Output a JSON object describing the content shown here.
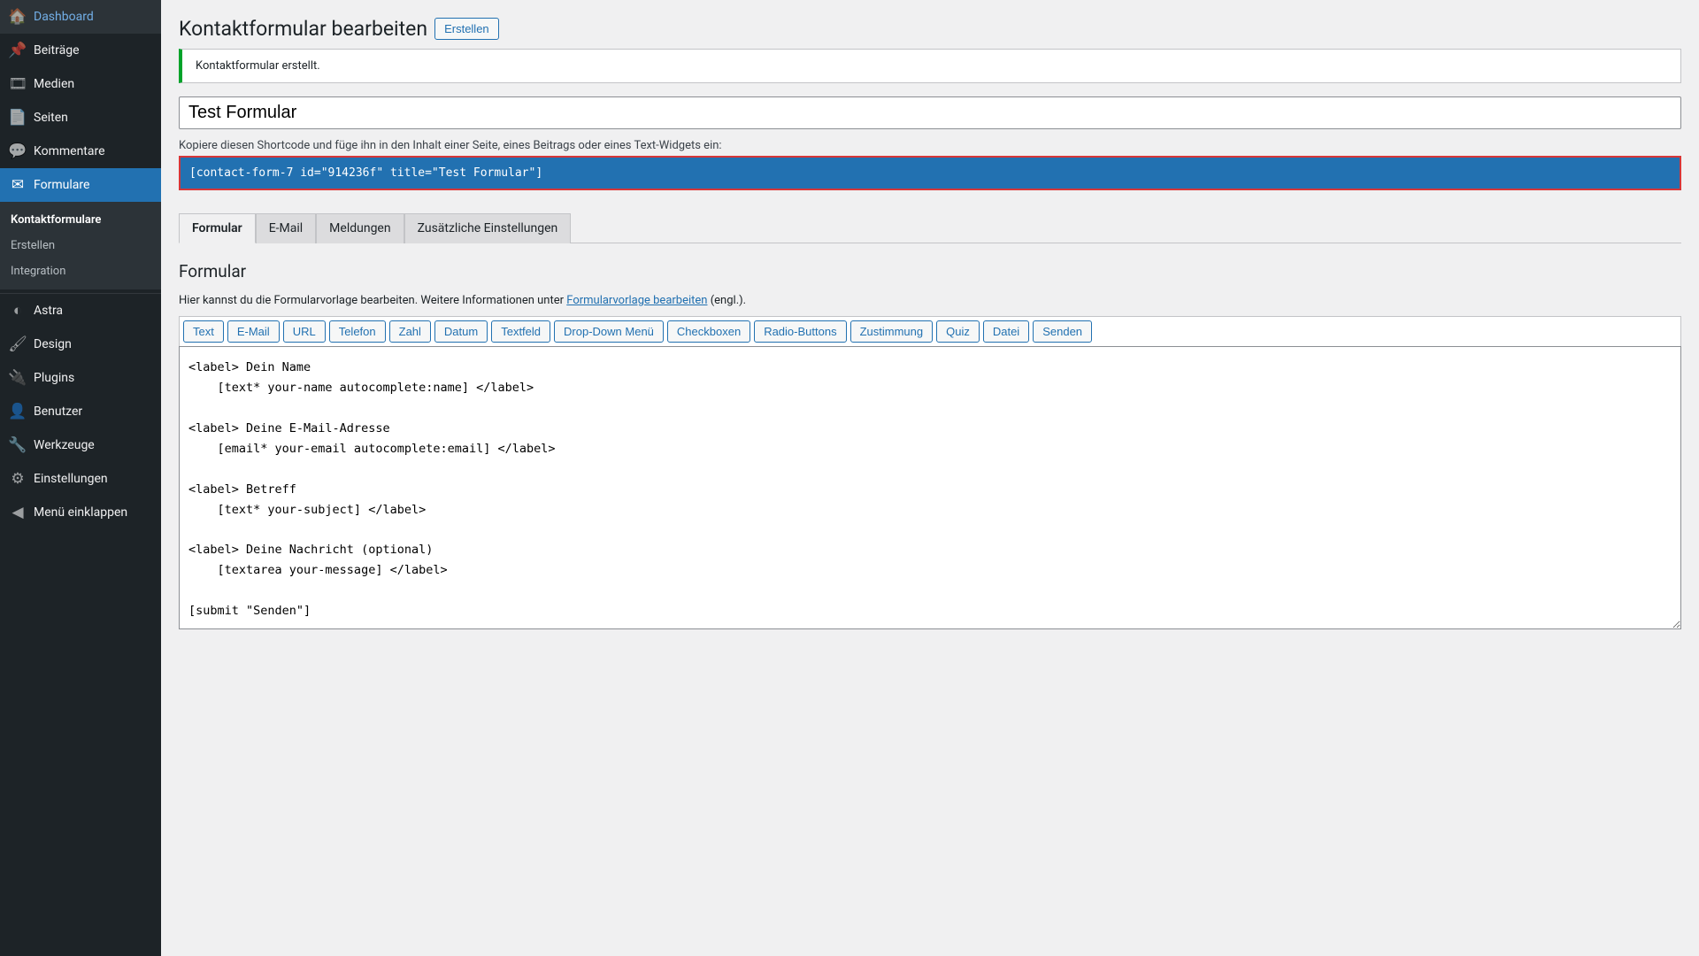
{
  "sidebar": {
    "items": [
      {
        "icon": "🏠",
        "label": "Dashboard"
      },
      {
        "icon": "📌",
        "label": "Beiträge"
      },
      {
        "icon": "🎞",
        "label": "Medien"
      },
      {
        "icon": "📄",
        "label": "Seiten"
      },
      {
        "icon": "💬",
        "label": "Kommentare"
      },
      {
        "icon": "✉",
        "label": "Formulare",
        "active": true
      }
    ],
    "submenu": [
      {
        "label": "Kontaktformulare",
        "current": true
      },
      {
        "label": "Erstellen"
      },
      {
        "label": "Integration"
      }
    ],
    "items2": [
      {
        "icon": "◐",
        "label": "Astra"
      },
      {
        "icon": "🖌",
        "label": "Design"
      },
      {
        "icon": "🔌",
        "label": "Plugins"
      },
      {
        "icon": "👤",
        "label": "Benutzer"
      },
      {
        "icon": "🔧",
        "label": "Werkzeuge"
      },
      {
        "icon": "⚙",
        "label": "Einstellungen"
      },
      {
        "icon": "◀",
        "label": "Menü einklappen"
      }
    ]
  },
  "header": {
    "title": "Kontaktformular bearbeiten",
    "create_btn": "Erstellen"
  },
  "notice": "Kontaktformular erstellt.",
  "form_title": "Test Formular",
  "shortcode_hint": "Kopiere diesen Shortcode und füge ihn in den Inhalt einer Seite, eines Beitrags oder eines Text-Widgets ein:",
  "shortcode": "[contact-form-7 id=\"914236f\" title=\"Test Formular\"]",
  "tabs": [
    {
      "label": "Formular",
      "active": true
    },
    {
      "label": "E-Mail"
    },
    {
      "label": "Meldungen"
    },
    {
      "label": "Zusätzliche Einstellungen"
    }
  ],
  "panel": {
    "title": "Formular",
    "desc_pre": "Hier kannst du die Formularvorlage bearbeiten. Weitere Informationen unter ",
    "desc_link": "Formularvorlage bearbeiten",
    "desc_post": " (engl.).",
    "tag_buttons": [
      "Text",
      "E-Mail",
      "URL",
      "Telefon",
      "Zahl",
      "Datum",
      "Textfeld",
      "Drop-Down Menü",
      "Checkboxen",
      "Radio-Buttons",
      "Zustimmung",
      "Quiz",
      "Datei",
      "Senden"
    ],
    "editor": "<label> Dein Name\n    [text* your-name autocomplete:name] </label>\n\n<label> Deine E-Mail-Adresse\n    [email* your-email autocomplete:email] </label>\n\n<label> Betreff\n    [text* your-subject] </label>\n\n<label> Deine Nachricht (optional)\n    [textarea your-message] </label>\n\n[submit \"Senden\"]"
  }
}
